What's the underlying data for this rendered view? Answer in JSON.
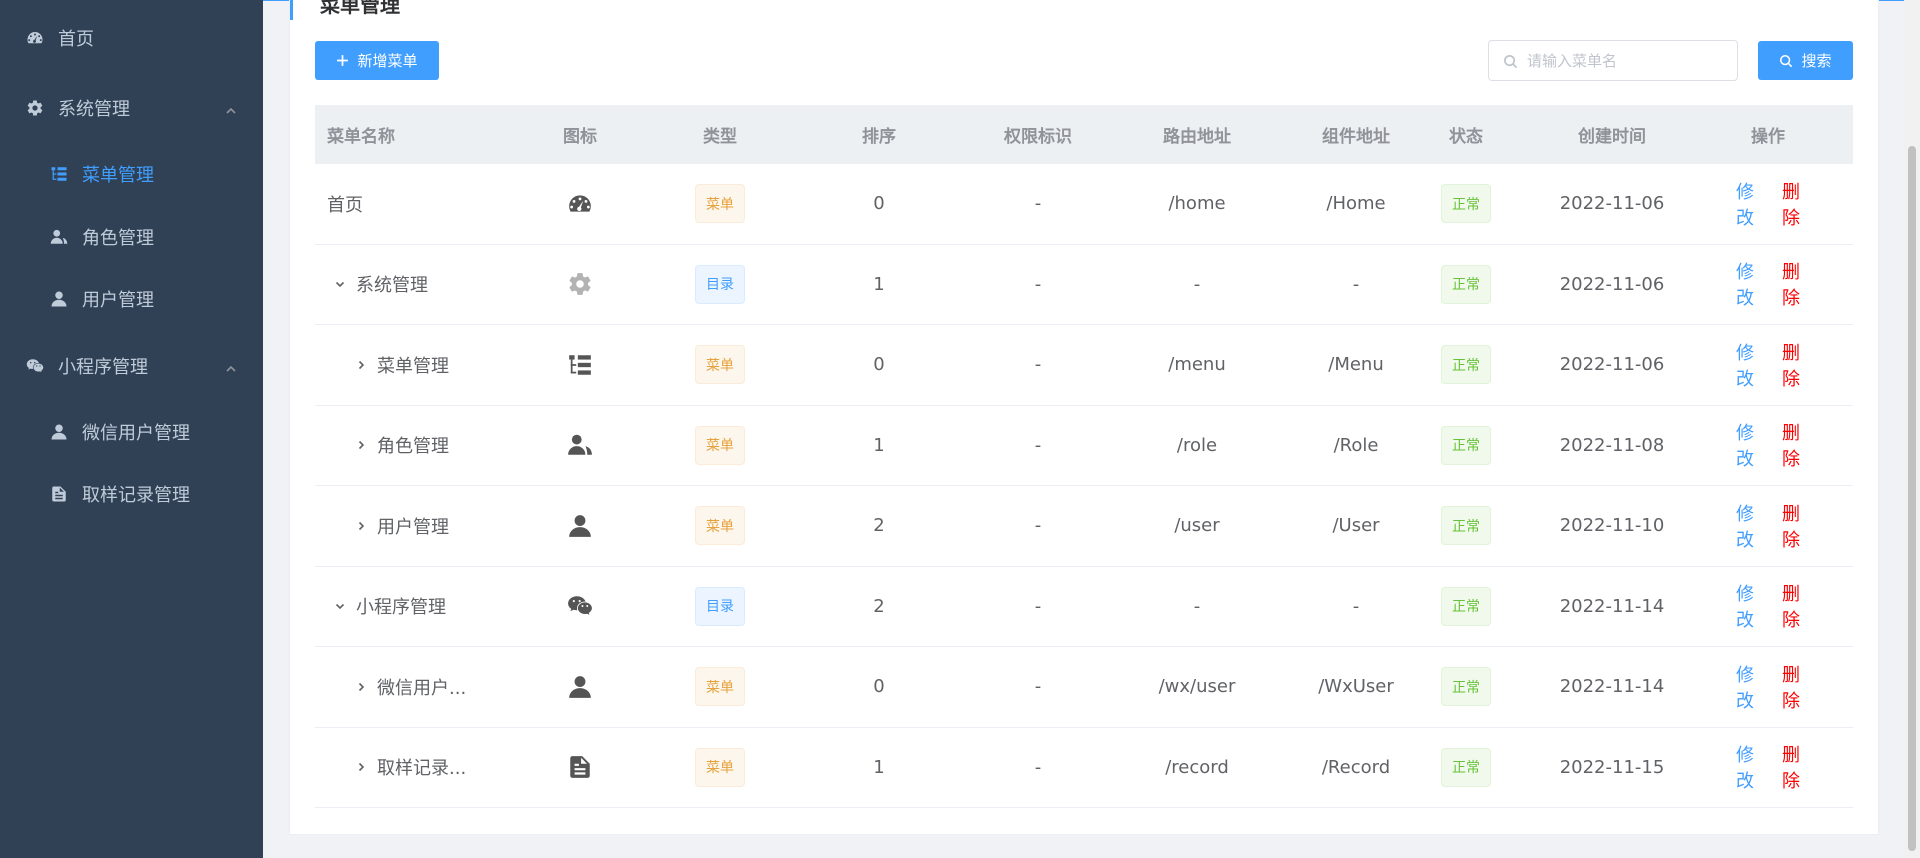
{
  "sidebar": {
    "items": [
      {
        "label": "首页",
        "icon": "dashboard-icon"
      },
      {
        "label": "系统管理",
        "icon": "gear-icon"
      },
      {
        "label": "菜单管理",
        "icon": "tree-list-icon"
      },
      {
        "label": "角色管理",
        "icon": "users-icon"
      },
      {
        "label": "用户管理",
        "icon": "user-icon"
      },
      {
        "label": "小程序管理",
        "icon": "wechat-icon"
      },
      {
        "label": "微信用户管理",
        "icon": "user-icon"
      },
      {
        "label": "取样记录管理",
        "icon": "document-icon"
      }
    ]
  },
  "page": {
    "title": "菜单管理",
    "add_button": "新增菜单",
    "search_placeholder": "请输入菜单名",
    "search_button": "搜索"
  },
  "table": {
    "headers": {
      "name": "菜单名称",
      "icon": "图标",
      "type": "类型",
      "sort": "排序",
      "perm": "权限标识",
      "path": "路由地址",
      "component": "组件地址",
      "status": "状态",
      "created": "创建时间",
      "ops": "操作"
    },
    "actions": {
      "edit": "修改",
      "delete": "删除"
    },
    "rows": [
      {
        "name": "首页",
        "icon": "dashboard-icon",
        "type": "菜单",
        "sort": "0",
        "perm": "-",
        "path": "/home",
        "component": "/Home",
        "status": "正常",
        "created": "2022-11-06"
      },
      {
        "name": "系统管理",
        "icon": "gear-icon",
        "type": "目录",
        "sort": "1",
        "perm": "-",
        "path": "-",
        "component": "-",
        "status": "正常",
        "created": "2022-11-06"
      },
      {
        "name": "菜单管理",
        "icon": "tree-list-icon",
        "type": "菜单",
        "sort": "0",
        "perm": "-",
        "path": "/menu",
        "component": "/Menu",
        "status": "正常",
        "created": "2022-11-06"
      },
      {
        "name": "角色管理",
        "icon": "users-icon",
        "type": "菜单",
        "sort": "1",
        "perm": "-",
        "path": "/role",
        "component": "/Role",
        "status": "正常",
        "created": "2022-11-08"
      },
      {
        "name": "用户管理",
        "icon": "user-icon",
        "type": "菜单",
        "sort": "2",
        "perm": "-",
        "path": "/user",
        "component": "/User",
        "status": "正常",
        "created": "2022-11-10"
      },
      {
        "name": "小程序管理",
        "icon": "wechat-icon",
        "type": "目录",
        "sort": "2",
        "perm": "-",
        "path": "-",
        "component": "-",
        "status": "正常",
        "created": "2022-11-14"
      },
      {
        "name": "微信用户...",
        "icon": "user-icon",
        "type": "菜单",
        "sort": "0",
        "perm": "-",
        "path": "/wx/user",
        "component": "/WxUser",
        "status": "正常",
        "created": "2022-11-14"
      },
      {
        "name": "取样记录...",
        "icon": "document-icon",
        "type": "菜单",
        "sort": "1",
        "perm": "-",
        "path": "/record",
        "component": "/Record",
        "status": "正常",
        "created": "2022-11-15"
      }
    ]
  },
  "colors": {
    "accent": "#409eff",
    "sidebar_bg": "#304156",
    "danger": "#ff0000",
    "warning": "#e6a23c",
    "success": "#67c23a"
  }
}
